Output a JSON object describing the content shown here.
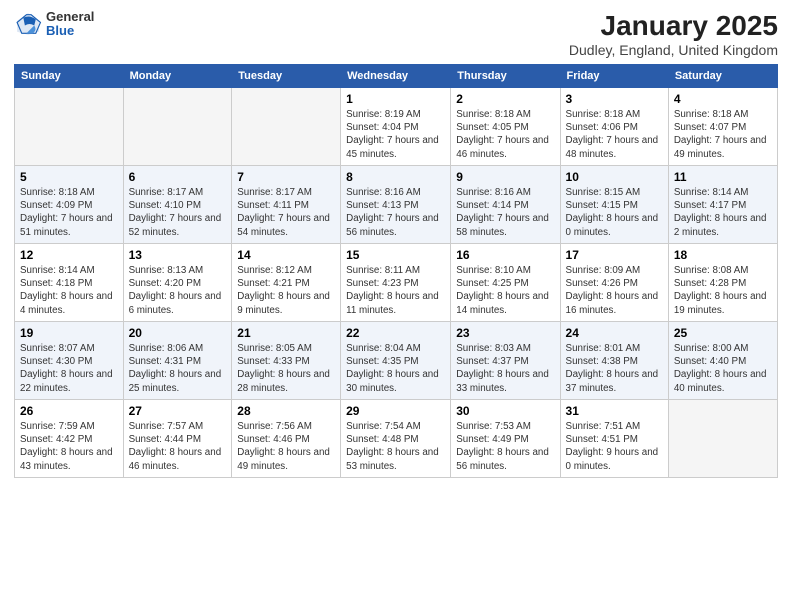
{
  "logo": {
    "general": "General",
    "blue": "Blue"
  },
  "title": "January 2025",
  "location": "Dudley, England, United Kingdom",
  "days_of_week": [
    "Sunday",
    "Monday",
    "Tuesday",
    "Wednesday",
    "Thursday",
    "Friday",
    "Saturday"
  ],
  "weeks": [
    [
      {
        "num": "",
        "info": ""
      },
      {
        "num": "",
        "info": ""
      },
      {
        "num": "",
        "info": ""
      },
      {
        "num": "1",
        "info": "Sunrise: 8:19 AM\nSunset: 4:04 PM\nDaylight: 7 hours\nand 45 minutes."
      },
      {
        "num": "2",
        "info": "Sunrise: 8:18 AM\nSunset: 4:05 PM\nDaylight: 7 hours\nand 46 minutes."
      },
      {
        "num": "3",
        "info": "Sunrise: 8:18 AM\nSunset: 4:06 PM\nDaylight: 7 hours\nand 48 minutes."
      },
      {
        "num": "4",
        "info": "Sunrise: 8:18 AM\nSunset: 4:07 PM\nDaylight: 7 hours\nand 49 minutes."
      }
    ],
    [
      {
        "num": "5",
        "info": "Sunrise: 8:18 AM\nSunset: 4:09 PM\nDaylight: 7 hours\nand 51 minutes."
      },
      {
        "num": "6",
        "info": "Sunrise: 8:17 AM\nSunset: 4:10 PM\nDaylight: 7 hours\nand 52 minutes."
      },
      {
        "num": "7",
        "info": "Sunrise: 8:17 AM\nSunset: 4:11 PM\nDaylight: 7 hours\nand 54 minutes."
      },
      {
        "num": "8",
        "info": "Sunrise: 8:16 AM\nSunset: 4:13 PM\nDaylight: 7 hours\nand 56 minutes."
      },
      {
        "num": "9",
        "info": "Sunrise: 8:16 AM\nSunset: 4:14 PM\nDaylight: 7 hours\nand 58 minutes."
      },
      {
        "num": "10",
        "info": "Sunrise: 8:15 AM\nSunset: 4:15 PM\nDaylight: 8 hours\nand 0 minutes."
      },
      {
        "num": "11",
        "info": "Sunrise: 8:14 AM\nSunset: 4:17 PM\nDaylight: 8 hours\nand 2 minutes."
      }
    ],
    [
      {
        "num": "12",
        "info": "Sunrise: 8:14 AM\nSunset: 4:18 PM\nDaylight: 8 hours\nand 4 minutes."
      },
      {
        "num": "13",
        "info": "Sunrise: 8:13 AM\nSunset: 4:20 PM\nDaylight: 8 hours\nand 6 minutes."
      },
      {
        "num": "14",
        "info": "Sunrise: 8:12 AM\nSunset: 4:21 PM\nDaylight: 8 hours\nand 9 minutes."
      },
      {
        "num": "15",
        "info": "Sunrise: 8:11 AM\nSunset: 4:23 PM\nDaylight: 8 hours\nand 11 minutes."
      },
      {
        "num": "16",
        "info": "Sunrise: 8:10 AM\nSunset: 4:25 PM\nDaylight: 8 hours\nand 14 minutes."
      },
      {
        "num": "17",
        "info": "Sunrise: 8:09 AM\nSunset: 4:26 PM\nDaylight: 8 hours\nand 16 minutes."
      },
      {
        "num": "18",
        "info": "Sunrise: 8:08 AM\nSunset: 4:28 PM\nDaylight: 8 hours\nand 19 minutes."
      }
    ],
    [
      {
        "num": "19",
        "info": "Sunrise: 8:07 AM\nSunset: 4:30 PM\nDaylight: 8 hours\nand 22 minutes."
      },
      {
        "num": "20",
        "info": "Sunrise: 8:06 AM\nSunset: 4:31 PM\nDaylight: 8 hours\nand 25 minutes."
      },
      {
        "num": "21",
        "info": "Sunrise: 8:05 AM\nSunset: 4:33 PM\nDaylight: 8 hours\nand 28 minutes."
      },
      {
        "num": "22",
        "info": "Sunrise: 8:04 AM\nSunset: 4:35 PM\nDaylight: 8 hours\nand 30 minutes."
      },
      {
        "num": "23",
        "info": "Sunrise: 8:03 AM\nSunset: 4:37 PM\nDaylight: 8 hours\nand 33 minutes."
      },
      {
        "num": "24",
        "info": "Sunrise: 8:01 AM\nSunset: 4:38 PM\nDaylight: 8 hours\nand 37 minutes."
      },
      {
        "num": "25",
        "info": "Sunrise: 8:00 AM\nSunset: 4:40 PM\nDaylight: 8 hours\nand 40 minutes."
      }
    ],
    [
      {
        "num": "26",
        "info": "Sunrise: 7:59 AM\nSunset: 4:42 PM\nDaylight: 8 hours\nand 43 minutes."
      },
      {
        "num": "27",
        "info": "Sunrise: 7:57 AM\nSunset: 4:44 PM\nDaylight: 8 hours\nand 46 minutes."
      },
      {
        "num": "28",
        "info": "Sunrise: 7:56 AM\nSunset: 4:46 PM\nDaylight: 8 hours\nand 49 minutes."
      },
      {
        "num": "29",
        "info": "Sunrise: 7:54 AM\nSunset: 4:48 PM\nDaylight: 8 hours\nand 53 minutes."
      },
      {
        "num": "30",
        "info": "Sunrise: 7:53 AM\nSunset: 4:49 PM\nDaylight: 8 hours\nand 56 minutes."
      },
      {
        "num": "31",
        "info": "Sunrise: 7:51 AM\nSunset: 4:51 PM\nDaylight: 9 hours\nand 0 minutes."
      },
      {
        "num": "",
        "info": ""
      }
    ]
  ]
}
